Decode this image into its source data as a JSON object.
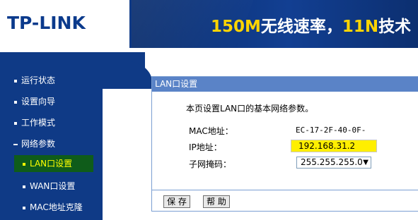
{
  "header": {
    "logo": "TP-LINK",
    "banner": {
      "part1": "150M",
      "part2": "无线速率，",
      "part3": "11N",
      "part4": "技术"
    }
  },
  "sidebar": {
    "items": [
      {
        "label": "运行状态"
      },
      {
        "label": "设置向导"
      },
      {
        "label": "工作模式"
      },
      {
        "label": "网络参数"
      },
      {
        "label": "LAN口设置"
      },
      {
        "label": "WAN口设置"
      },
      {
        "label": "MAC地址克隆"
      }
    ]
  },
  "panel": {
    "title": "LAN口设置",
    "description": "本页设置LAN口的基本网络参数。",
    "mac_label": "MAC地址：",
    "mac_value": "EC-17-2F-40-0F-",
    "ip_label": "IP地址：",
    "ip_value": "192.168.31.2",
    "subnet_label": "子网掩码：",
    "subnet_value": "255.255.255.0",
    "save_button": "保 存",
    "help_button": "帮 助"
  },
  "colors": {
    "nav_bg": "#0f3a86",
    "panel_title_bg": "#5a83c7",
    "active_bg": "#0f5c1a",
    "active_text": "#ffff00",
    "highlight": "#ffef00"
  }
}
